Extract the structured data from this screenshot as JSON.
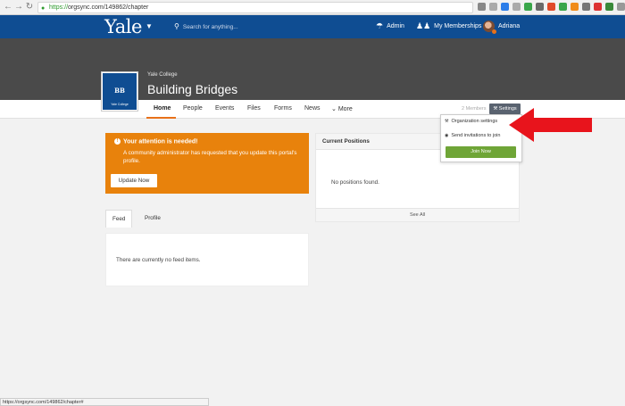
{
  "browser": {
    "url_scheme": "https://",
    "url_rest": "orgsync.com/149862/chapter",
    "status_url": "https://orgsync.com/149862/chapter#"
  },
  "topnav": {
    "logo": "Yale",
    "search_placeholder": "Search for anything...",
    "admin_label": "Admin",
    "memberships_label": "My Memberships",
    "user_name": "Adriana",
    "brand_color": "#0f4d92"
  },
  "banner": {
    "parent": "Yale College",
    "title": "Building Bridges",
    "logo_initials": "BB",
    "logo_sub": "Yale College"
  },
  "tabs": {
    "items": [
      "Home",
      "People",
      "Events",
      "Files",
      "Forms",
      "News",
      "More"
    ],
    "active": "Home",
    "members_count": "2 Members",
    "settings_label": "Settings"
  },
  "settings_menu": {
    "org_settings": "Organization settings",
    "send_invites": "Send invitations to join",
    "join_now": "Join Now"
  },
  "attention": {
    "title": "Your attention is needed!",
    "body": "A community administrator has requested that you update this portal's profile.",
    "button": "Update Now",
    "color": "#e8820c"
  },
  "positions": {
    "header": "Current Positions",
    "empty": "No positions found.",
    "footer": "See All"
  },
  "feed": {
    "tab_feed": "Feed",
    "tab_profile": "Profile",
    "empty": "There are currently no feed items."
  }
}
